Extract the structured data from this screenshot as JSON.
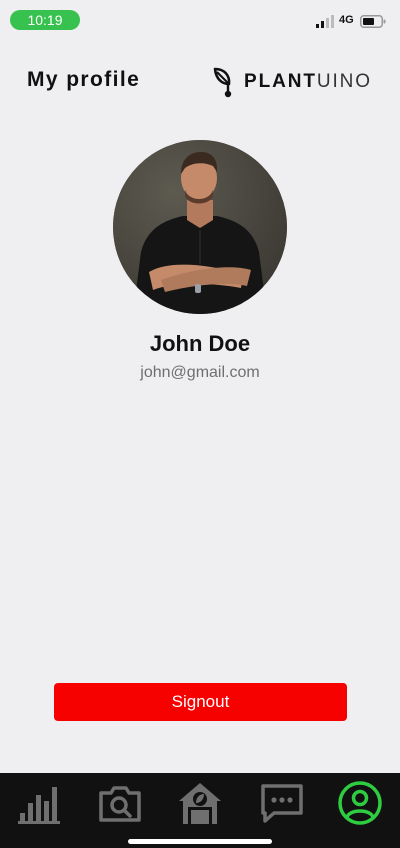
{
  "status_bar": {
    "time": "10:19",
    "network": "4G"
  },
  "header": {
    "title": "My profile",
    "brand_bold": "PLANT",
    "brand_light": "UINO"
  },
  "profile": {
    "name": "John Doe",
    "email": "john@gmail.com"
  },
  "actions": {
    "signout_label": "Signout"
  },
  "nav": {
    "items": [
      {
        "icon": "bar-chart-icon",
        "active": false
      },
      {
        "icon": "camera-search-icon",
        "active": false
      },
      {
        "icon": "greenhouse-icon",
        "active": false
      },
      {
        "icon": "chat-icon",
        "active": false
      },
      {
        "icon": "user-profile-icon",
        "active": true
      }
    ]
  },
  "colors": {
    "background": "#efeff1",
    "status_pill": "#37c24f",
    "signout_button": "#f70000",
    "nav_background": "#111111",
    "nav_icon_inactive": "#6f6f6f",
    "nav_icon_active": "#2ecc40"
  }
}
